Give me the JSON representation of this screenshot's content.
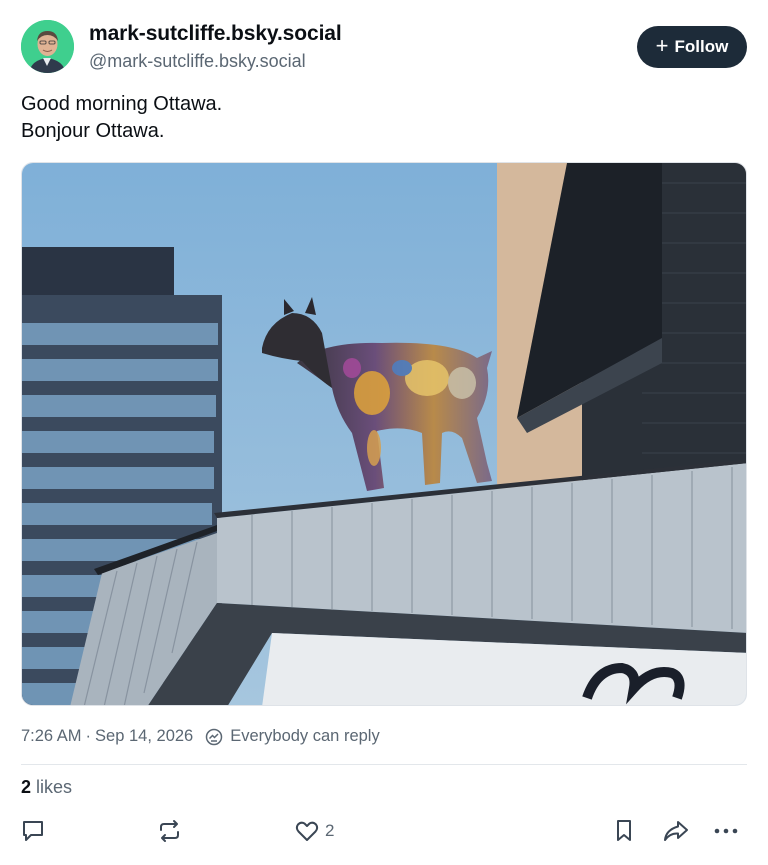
{
  "post": {
    "author": {
      "display_name": "mark-sutcliffe.bsky.social",
      "handle": "@mark-sutcliffe.bsky.social",
      "avatar_icon": "profile-photo"
    },
    "follow_button": {
      "icon": "plus-icon",
      "label": "Follow"
    },
    "text_lines": [
      "Good morning Ottawa.",
      "Bonjour Ottawa."
    ],
    "image": {
      "icon": "photo-graffiti-goat-statue-on-roof"
    },
    "timestamp": "7:26 AM",
    "separator": "·",
    "date": "Sep 14, 2026",
    "reply_setting": {
      "icon": "globe-reply-icon",
      "label": "Everybody can reply"
    },
    "likes": {
      "count": "2",
      "label": "likes"
    },
    "actions": {
      "reply_icon": "comment-icon",
      "repost_icon": "repost-icon",
      "like_icon": "heart-icon",
      "like_count": "2",
      "bookmark_icon": "bookmark-icon",
      "share_icon": "share-icon",
      "more_icon": "more-dots-icon"
    }
  },
  "colors": {
    "follow_button_bg": "#1d2b39",
    "secondary_text": "#5b6773",
    "primary_text": "#0b0f14",
    "avatar_bg": "#39c98a",
    "sky": "#87b3d6"
  }
}
